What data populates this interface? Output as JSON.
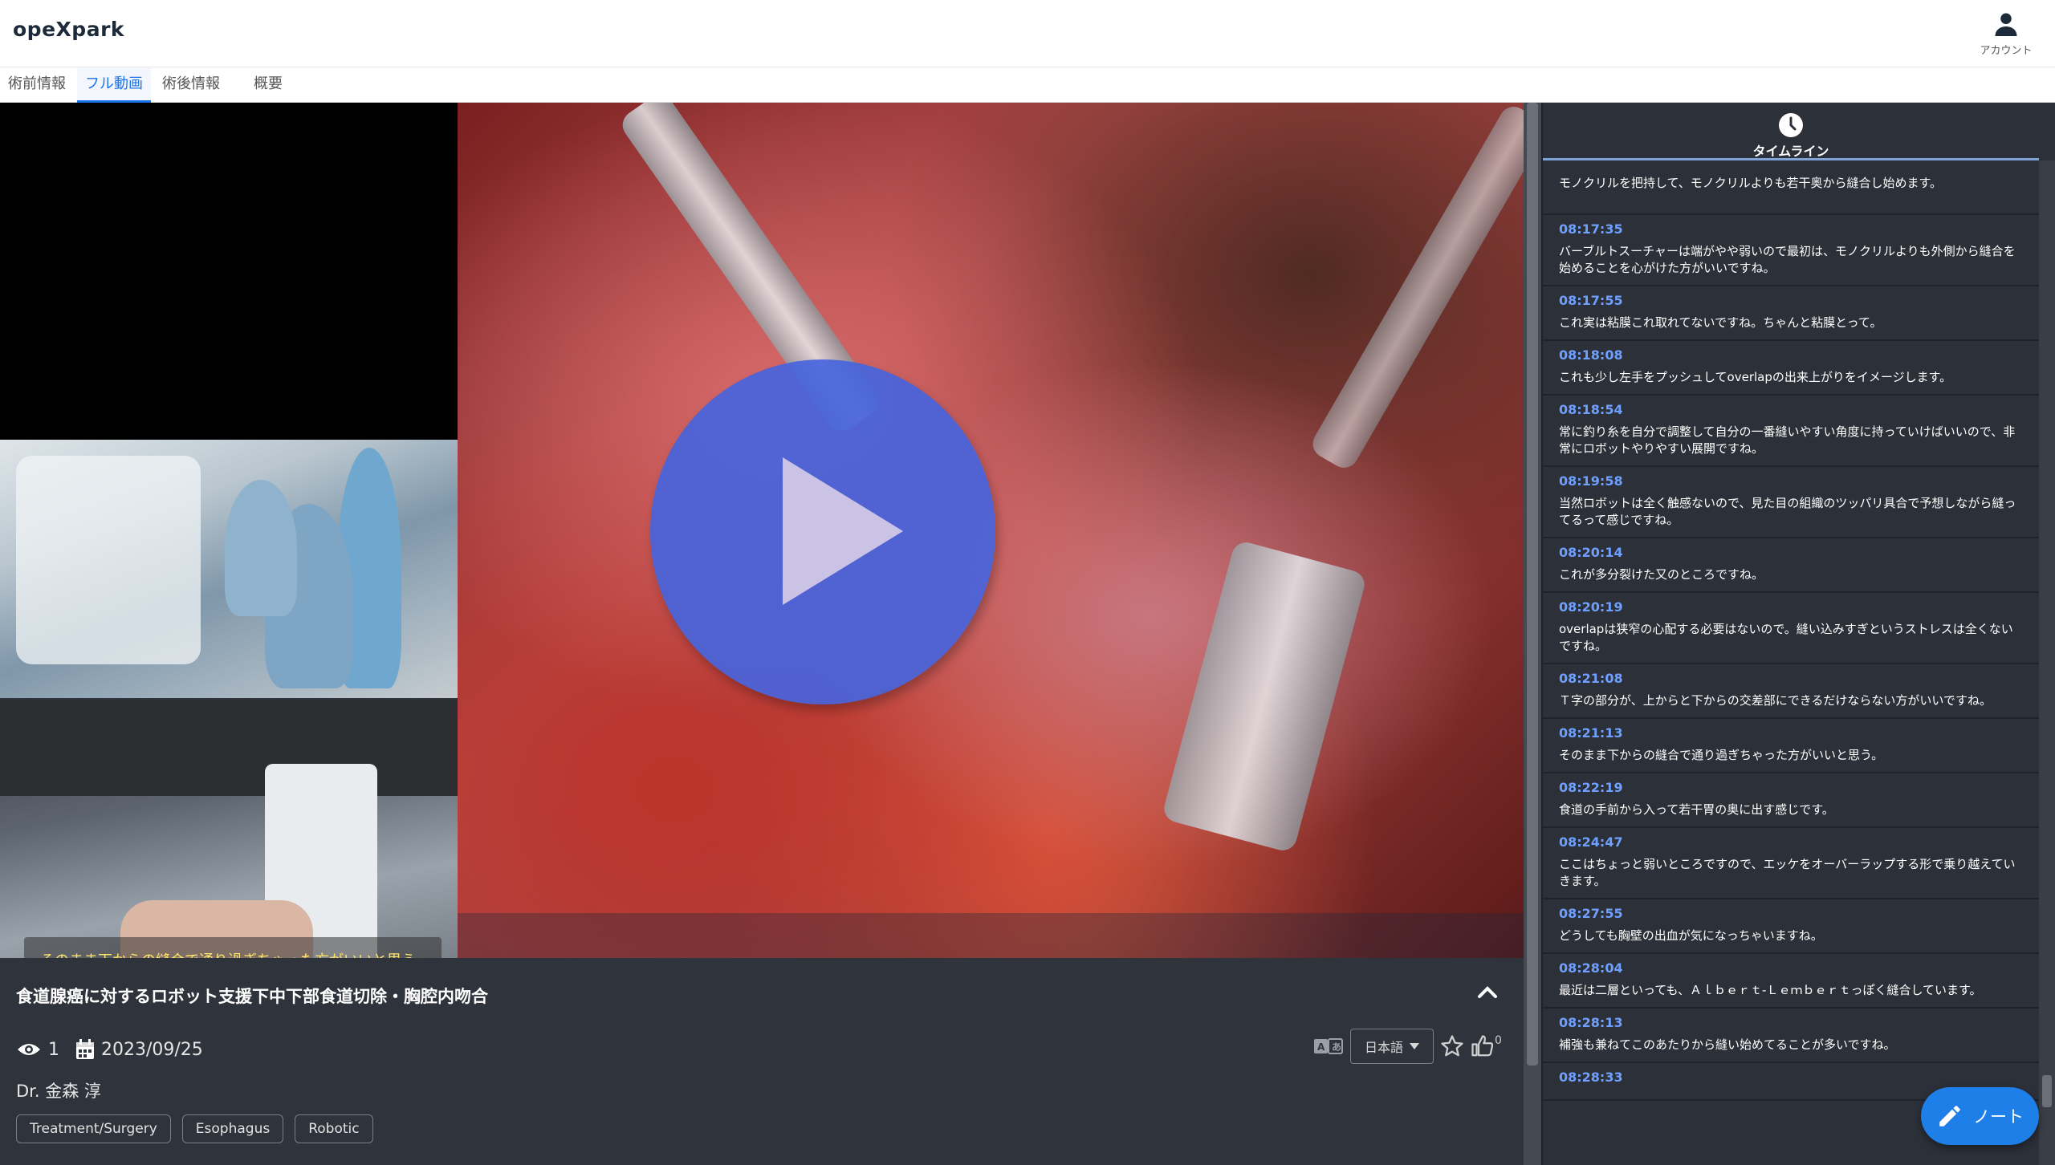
{
  "app": {
    "logo": "opeXpark",
    "account_label": "アカウント"
  },
  "tabs": [
    {
      "label": "術前情報"
    },
    {
      "label": "フル動画",
      "active": true
    },
    {
      "label": "術後情報"
    },
    {
      "label": "概要"
    }
  ],
  "player": {
    "subtitle": "そのまま下からの縫合で通り過ぎちゃった方がいいと思う。"
  },
  "video": {
    "title": "食道腺癌に対するロボット支援下中下部食道切除・胸腔内吻合",
    "views": "1",
    "date": "2023/09/25",
    "doctor": "Dr. 金森 淳",
    "tags": [
      "Treatment/Surgery",
      "Esophagus",
      "Robotic"
    ],
    "language": "日本語",
    "like_count": "0"
  },
  "timeline": {
    "title": "タイムライン",
    "first_partial_text": "モノクリルを把持して、モノクリルよりも若干奥から縫合し始めます。",
    "entries": [
      {
        "time": "08:17:35",
        "text": "バーブルトスーチャーは端がやや弱いので最初は、モノクリルよりも外側から縫合を始めることを心がけた方がいいですね。"
      },
      {
        "time": "08:17:55",
        "text": "これ実は粘膜これ取れてないですね。ちゃんと粘膜とって。"
      },
      {
        "time": "08:18:08",
        "text": "これも少し左手をプッシュしてoverlapの出来上がりをイメージします。"
      },
      {
        "time": "08:18:54",
        "text": "常に釣り糸を自分で調整して自分の一番縫いやすい角度に持っていけばいいので、非常にロボットやりやすい展開ですね。"
      },
      {
        "time": "08:19:58",
        "text": "当然ロボットは全く触感ないので、見た目の組織のツッパリ具合で予想しながら縫ってるって感じですね。"
      },
      {
        "time": "08:20:14",
        "text": "これが多分裂けた又のところですね。"
      },
      {
        "time": "08:20:19",
        "text": "overlapは狭窄の心配する必要はないので。縫い込みすぎというストレスは全くないですね。"
      },
      {
        "time": "08:21:08",
        "text": "Ｔ字の部分が、上からと下からの交差部にできるだけならない方がいいですね。"
      },
      {
        "time": "08:21:13",
        "text": "そのまま下からの縫合で通り過ぎちゃった方がいいと思う。"
      },
      {
        "time": "08:22:19",
        "text": "食道の手前から入って若干胃の奥に出す感じです。"
      },
      {
        "time": "08:24:47",
        "text": "ここはちょっと弱いところですので、エッケをオーバーラップする形で乗り越えていきます。"
      },
      {
        "time": "08:27:55",
        "text": "どうしても胸壁の出血が気になっちゃいますね。"
      },
      {
        "time": "08:28:04",
        "text": "最近は二層といっても、Ａｌｂｅｒｔ-Ｌｅｍｂｅｒｔっぽく縫合しています。"
      },
      {
        "time": "08:28:13",
        "text": "補強も兼ねてこのあたりから縫い始めてることが多いですね。"
      },
      {
        "time": "08:28:33",
        "text": ""
      }
    ]
  },
  "note_button": {
    "label": "ノート"
  },
  "colors": {
    "accent": "#1a73e8",
    "timeline_time": "#6fa0ff",
    "play": "#4664dc"
  }
}
